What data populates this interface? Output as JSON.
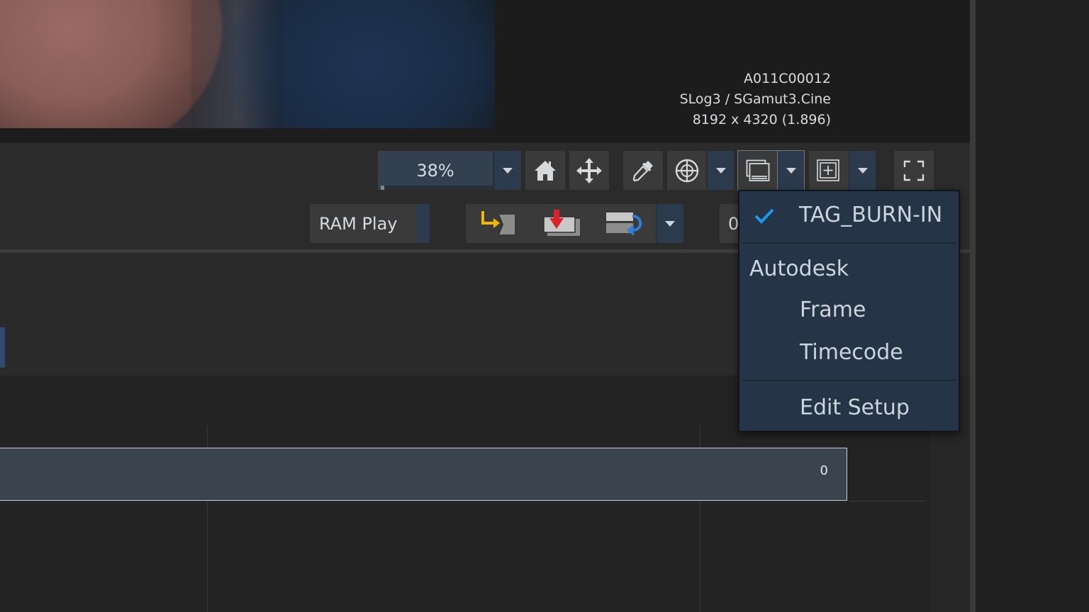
{
  "clip_info": {
    "name": "A011C00012",
    "colorspace": "SLog3 / SGamut3.Cine",
    "resolution": "8192 x 4320 (1.896)"
  },
  "toolbar": {
    "zoom_value": "38%",
    "ram_play_label": "RAM Play",
    "partial_label": "0"
  },
  "timeline": {
    "track_value": "0"
  },
  "burnin_menu": {
    "checked_item": "TAG_BURN-IN",
    "group_header": "Autodesk",
    "items": [
      "Frame",
      "Timecode"
    ],
    "edit_label": "Edit Setup"
  },
  "colors": {
    "accent_check": "#1e9be8",
    "menu_background": "#253446",
    "arrow_yellow": "#f2b705",
    "arrow_red": "#d9222a",
    "arrow_blue": "#2d7fd6"
  },
  "icons": [
    "home-icon",
    "move-icon",
    "eyedropper-icon",
    "crosshair-icon",
    "burnin-overlay-icon",
    "add-overlay-icon",
    "fullscreen-icon",
    "insert-icon",
    "overwrite-icon",
    "replace-icon",
    "checkmark-icon"
  ]
}
